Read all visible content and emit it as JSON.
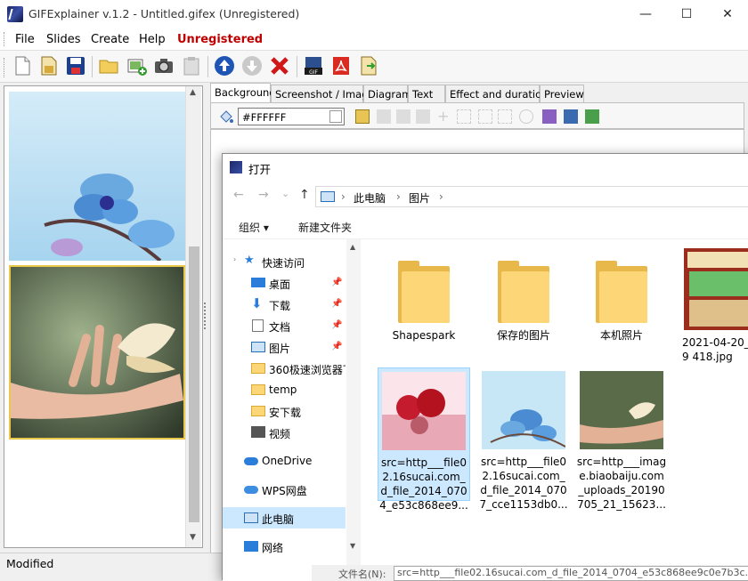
{
  "window": {
    "title": "GIFExplainer v.1.2 - Untitled.gifex (Unregistered)",
    "minimize": "—",
    "maximize": "☐",
    "close": "✕"
  },
  "menu": {
    "file": "File",
    "slides": "Slides",
    "create": "Create",
    "help": "Help",
    "unregistered": "Unregistered"
  },
  "toolbar": {
    "icons": [
      "new-document-icon",
      "open-icon",
      "save-icon",
      "folder-icon",
      "add-slide-icon",
      "screenshot-icon",
      "paste-icon",
      "move-up-icon",
      "move-down-icon",
      "delete-icon",
      "gif-export-icon",
      "pdf-export-icon",
      "export-icon"
    ]
  },
  "tabs": [
    "Background",
    "Screenshot / Image",
    "Diagram",
    "Text",
    "Effect and duration",
    "Preview"
  ],
  "background": {
    "color_value": "#FFFFFF"
  },
  "status": {
    "text": "Modified"
  },
  "dialog": {
    "title": "打开",
    "back": "←",
    "forward": "→",
    "recent": "⌄",
    "up": "↑",
    "breadcrumb": [
      "此电脑",
      "图片"
    ],
    "breadcrumb_sep": "›",
    "organize": "组织 ▾",
    "new_folder": "新建文件夹",
    "nav": [
      {
        "label": "快速访问",
        "icon": "star-icon"
      },
      {
        "label": "桌面",
        "icon": "desktop-icon"
      },
      {
        "label": "下载",
        "icon": "download-icon"
      },
      {
        "label": "文档",
        "icon": "document-icon"
      },
      {
        "label": "图片",
        "icon": "picture-icon"
      },
      {
        "label": "360极速浏览器下",
        "icon": "folder-icon"
      },
      {
        "label": "temp",
        "icon": "folder-icon"
      },
      {
        "label": "安下载",
        "icon": "folder-icon"
      },
      {
        "label": "视频",
        "icon": "video-icon"
      },
      {
        "label": "OneDrive",
        "icon": "cloud-icon"
      },
      {
        "label": "WPS网盘",
        "icon": "cloud-icon"
      },
      {
        "label": "此电脑",
        "icon": "computer-icon"
      },
      {
        "label": "网络",
        "icon": "network-icon"
      }
    ],
    "files": [
      {
        "label": "Shapespark",
        "type": "folder"
      },
      {
        "label": "保存的图片",
        "type": "folder"
      },
      {
        "label": "本机照片",
        "type": "folder"
      },
      {
        "label": "2021-04-20_09 418.jpg",
        "type": "image"
      },
      {
        "label": "src=http___file0 2.16sucai.com_ d_file_2014_070 4_e53c868ee9...",
        "type": "image"
      },
      {
        "label": "src=http___file0 2.16sucai.com_ d_file_2014_070 7_cce1153db0...",
        "type": "image"
      },
      {
        "label": "src=http___imag e.biaobaiju.com _uploads_20190 705_21_15623...",
        "type": "image"
      }
    ],
    "filename_label": "文件名(N):",
    "filename_value": "src=http___file02.16sucai.com_d_file_2014_0704_e53c868ee9c0e7b3c..."
  }
}
